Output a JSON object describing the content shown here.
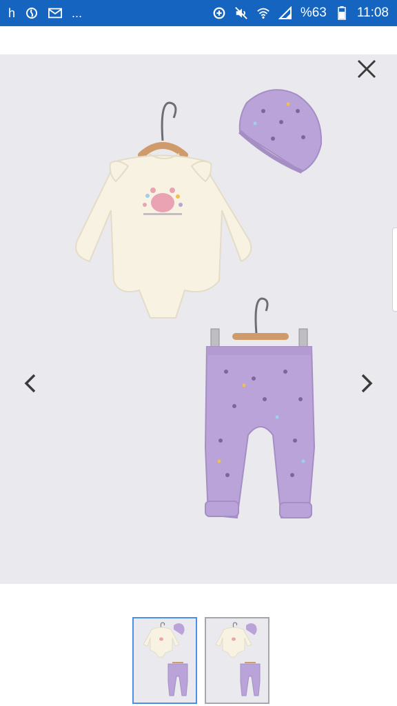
{
  "status_bar": {
    "left_letter": "h",
    "more_indicator": "...",
    "battery_percent": "%63",
    "time": "11:08",
    "icons": [
      "app-icon",
      "mail-icon",
      "data-saver-icon",
      "mute-icon",
      "wifi-icon",
      "signal-icon",
      "battery-icon"
    ]
  },
  "gallery": {
    "close_icon": "close-icon",
    "prev_icon": "chevron-left-icon",
    "next_icon": "chevron-right-icon",
    "product_items": [
      "bodysuit",
      "hat",
      "leggings"
    ],
    "colors": {
      "background": "#e9e9ee",
      "bodysuit": "#f7f2e2",
      "lilac": "#b9a3d8"
    }
  },
  "thumbnails": {
    "count": 2,
    "selected_index": 0,
    "selected_border": "#4a8fe7",
    "unselected_border": "#a6a6aa"
  }
}
